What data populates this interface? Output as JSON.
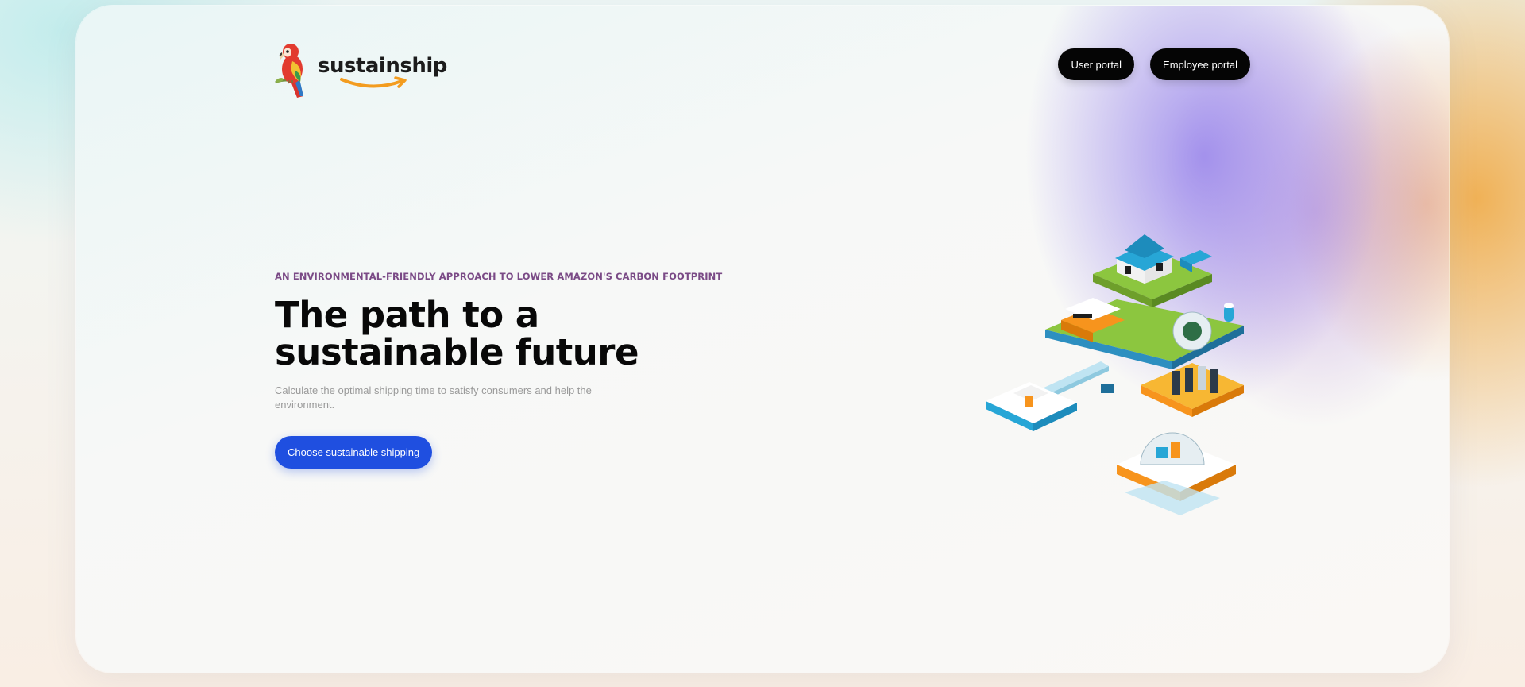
{
  "header": {
    "logo_text": "sustainship",
    "user_portal_label": "User portal",
    "employee_portal_label": "Employee portal"
  },
  "hero": {
    "eyebrow": "AN ENVIRONMENTAL-FRIENDLY APPROACH TO LOWER AMAZON'S CARBON FOOTPRINT",
    "title": "The path to a\nsustainable future",
    "subtitle": "Calculate the optimal shipping time to satisfy consumers and help the environment.",
    "cta_label": "Choose sustainable shipping"
  },
  "icons": {
    "logo": "parrot-icon",
    "illustration": "isometric-city-illustration"
  },
  "colors": {
    "cta_background": "#1f4fe0",
    "nav_button_background": "#050505",
    "eyebrow": "#7a4a86",
    "title": "#080808",
    "subtitle": "#9a9a9a"
  }
}
